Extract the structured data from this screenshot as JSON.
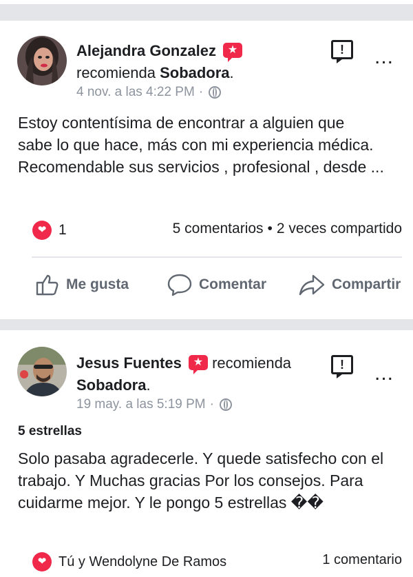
{
  "posts": [
    {
      "author": "Alejandra Gonzalez",
      "verb": "recomienda",
      "page": "Sobadora",
      "period": ".",
      "time": "4 nov. a las 4:22 PM",
      "time_sep": "·",
      "body_lines": [
        "Estoy contentísima de encontrar a alguien que",
        "sabe lo que hace, más con mi experiencia médica.",
        "Recomendable sus servicios , profesional , desde ..."
      ],
      "reactions": "1",
      "comments": "5 comentarios",
      "bullet": "•",
      "shares": "2 veces compartido"
    },
    {
      "author": "Jesus Fuentes",
      "verb": "recomienda",
      "page": "Sobadora",
      "period": ".",
      "time": "19 may. a las 5:19 PM",
      "time_sep": "·",
      "rating": "5 estrellas",
      "body_lines": [
        "Solo pasaba agradecerle. Y quede satisfecho con el",
        "trabajo.  Y Muchas gracias Por los consejos. Para",
        "cuidarme mejor.  Y le pongo 5 estrellas ��"
      ],
      "reactions": "Tú y Wendolyne De Ramos",
      "comments": "1 comentario"
    }
  ],
  "actions": {
    "like": "Me gusta",
    "comment": "Comentar",
    "share": "Compartir"
  },
  "icons": {
    "verified": "recommend-badge-icon",
    "report": "report-icon",
    "more": "more-options-icon",
    "globe": "globe-icon",
    "heart": "love-reaction-icon"
  },
  "colors": {
    "accent": "#f02849",
    "muted": "#8d949e",
    "action": "#606770",
    "separator": "#e4e5e9"
  },
  "verified_glyph": "★",
  "report_glyph": "!",
  "more_glyph": "..."
}
